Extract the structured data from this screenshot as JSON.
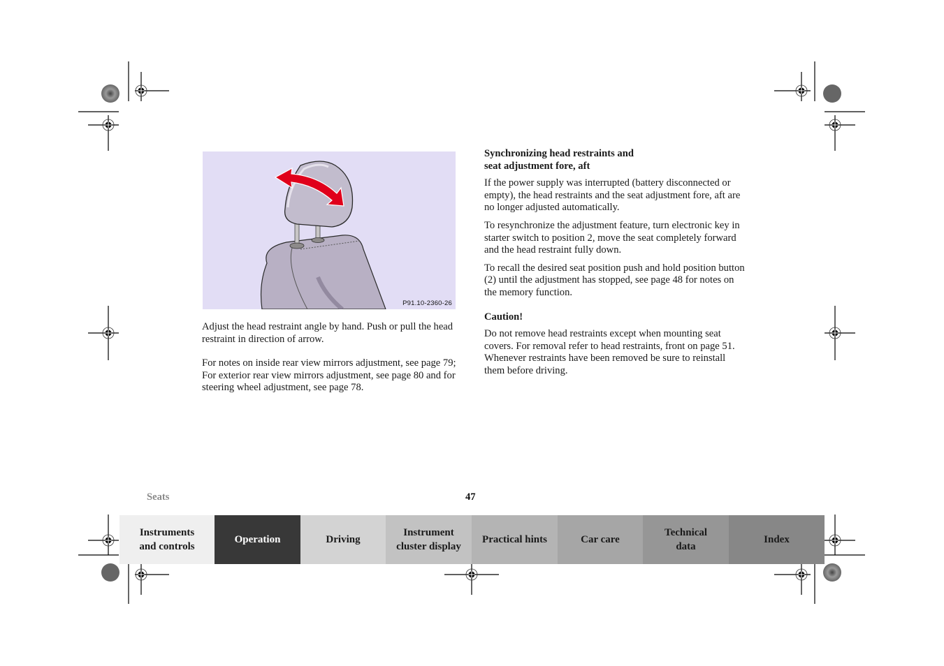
{
  "figure": {
    "code": "P91.10-2360-26",
    "background": "#e2ddf5",
    "arrow_color": "#e0001b",
    "icon": "head-restraint-tilt-illustration"
  },
  "left_column": {
    "paragraph1": "Adjust the head restraint angle by hand. Push or pull the head restraint in direction of arrow.",
    "paragraph2_line1": "For notes on inside rear view mirrors adjustment, see page 79;",
    "paragraph2_line2": "For exterior rear view mirrors adjustment, see page 80 and for steering wheel adjustment, see page 78."
  },
  "right_column": {
    "heading_line1": "Synchronizing head restraints and",
    "heading_line2": "seat adjustment fore, aft",
    "paragraph1": "If the power supply was interrupted (battery disconnected or empty), the head restraints and the seat adjustment fore, aft are no longer adjusted automatically.",
    "paragraph2": "To resynchronize the adjustment feature, turn electronic key in starter switch to position 2, move the seat completely forward and the head restraint fully down.",
    "paragraph3": "To recall the desired seat position push and hold position button (2) until the adjustment has stopped, see page 48 for notes on the memory function.",
    "caution_heading": "Caution!",
    "caution_text": "Do not remove head restraints except when mounting seat covers. For removal refer to head restraints, front on page 51. Whenever restraints have been removed be sure to reinstall them before driving."
  },
  "footer": {
    "section": "Seats",
    "page_number": "47"
  },
  "nav_tabs": [
    {
      "line1": "Instruments",
      "line2": "and controls",
      "bg": "#efefef",
      "fg": "#1a1a1a"
    },
    {
      "line1": "Operation",
      "line2": "",
      "bg": "#383838",
      "fg": "#ffffff",
      "active": true
    },
    {
      "line1": "Driving",
      "line2": "",
      "bg": "#d3d3d3",
      "fg": "#1a1a1a"
    },
    {
      "line1": "Instrument",
      "line2": "cluster display",
      "bg": "#c2c2c2",
      "fg": "#1a1a1a"
    },
    {
      "line1": "Practical hints",
      "line2": "",
      "bg": "#b4b4b4",
      "fg": "#1a1a1a"
    },
    {
      "line1": "Car care",
      "line2": "",
      "bg": "#a6a6a6",
      "fg": "#1a1a1a"
    },
    {
      "line1": "Technical",
      "line2": "data",
      "bg": "#969696",
      "fg": "#1a1a1a"
    },
    {
      "line1": "Index",
      "line2": "",
      "bg": "#878787",
      "fg": "#1a1a1a"
    }
  ]
}
